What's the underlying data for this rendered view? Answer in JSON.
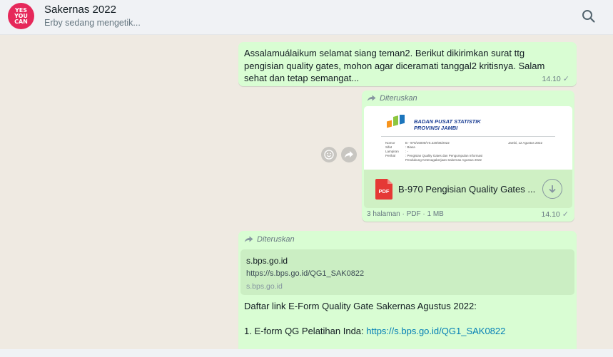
{
  "header": {
    "avatar_text": [
      "YES",
      "YOU",
      "CAN"
    ],
    "title": "Sakernas 2022",
    "status": "Erby sedang mengetik..."
  },
  "colors": {
    "outgoing_bubble": "#d9fdd3",
    "chat_background": "#efeae2",
    "link": "#027eb5",
    "avatar": "#e6285a"
  },
  "messages": [
    {
      "text": "Assalamuálaikum selamat siang teman2. Berikut dikirimkan surat ttg pengisian quality gates, mohon agar diceramati tanggal2 kritisnya. Salam sehat dan tetap semangat...",
      "time": "14.10"
    },
    {
      "forwarded_label": "Diteruskan",
      "preview": {
        "org_name_1": "BADAN PUSAT STATISTIK",
        "org_name_2": "PROVINSI JAMBI",
        "nomor": "B - 970/15000/VS.220/08/2022",
        "tanggal": "Jambi, 12 Agustus 2022",
        "labels": [
          "Nomor",
          "Sifat",
          "Lampiran",
          "Perihal"
        ],
        "sifat": ": Biasa",
        "lampiran": ": -",
        "perihal_1": ": Pengisian Quality Gates dan Pengumpulan Informasi",
        "perihal_2": "Pendukung Ketenagakerjaan Sakernas Agustus 2022"
      },
      "file_name": "B-970 Pengisian Quality Gates ...",
      "file_icon": "pdf-icon",
      "file_info": "3 halaman · PDF · 1 MB",
      "time": "14.10"
    },
    {
      "forwarded_label": "Diteruskan",
      "link_preview": {
        "title": "s.bps.go.id",
        "url": "https://s.bps.go.id/QG1_SAK0822",
        "domain": "s.bps.go.id"
      },
      "body_line_1": "Daftar link E-Form Quality Gate Sakernas Agustus 2022:",
      "body_line_2_prefix": "1. E-form QG Pelatihan Inda: ",
      "body_line_2_link": "https://s.bps.go.id/QG1_SAK0822"
    }
  ]
}
